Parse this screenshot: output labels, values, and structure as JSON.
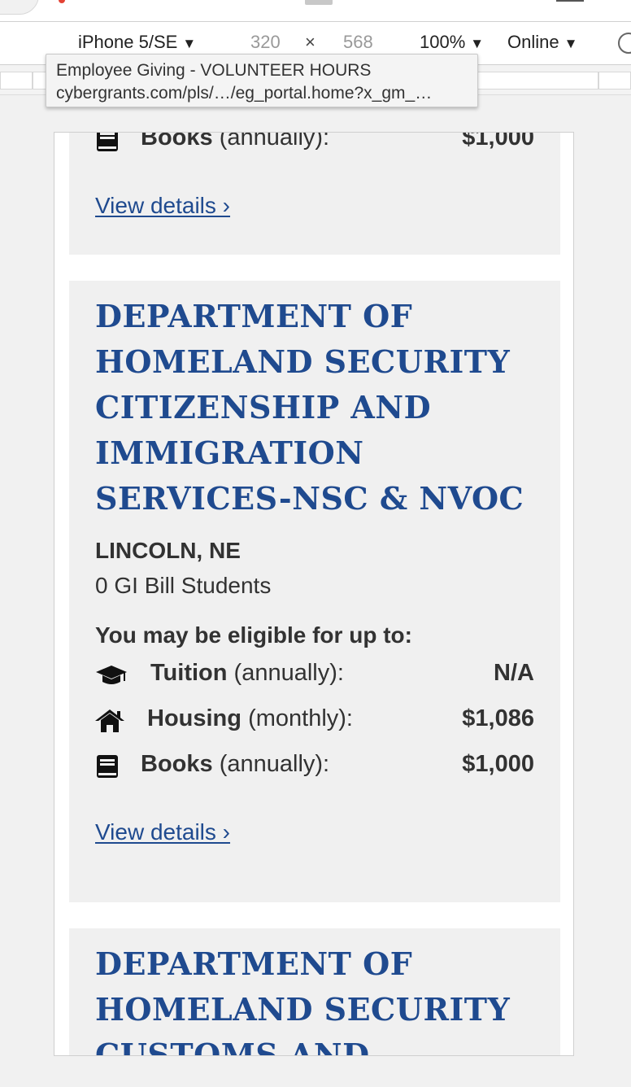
{
  "devtools": {
    "device": "iPhone 5/SE",
    "width": "320",
    "times": "×",
    "height": "568",
    "zoom": "100%",
    "network": "Online",
    "caret": "▼"
  },
  "tooltip": {
    "title": "Employee Giving - VOLUNTEER HOURS",
    "url": "cybergrants.com/pls/…/eg_portal.home?x_gm_…"
  },
  "cards": [
    {
      "books_label": "Books",
      "books_period": "(annually):",
      "books_value": "$1,000",
      "link": "View details ›"
    },
    {
      "title_lines": [
        "DEPARTMENT OF",
        "HOMELAND SECURITY",
        "CITIZENSHIP AND",
        "IMMIGRATION",
        "SERVICES-NSC & NVOC"
      ],
      "city": "LINCOLN, NE",
      "students": "0 GI Bill Students",
      "eligible": "You may be eligible for up to:",
      "benefits": [
        {
          "icon": "graduation-cap-icon",
          "label": "Tuition",
          "period": "(annually):",
          "value": "N/A"
        },
        {
          "icon": "home-icon",
          "label": "Housing",
          "period": "(monthly):",
          "value": "$1,086"
        },
        {
          "icon": "book-icon",
          "label": "Books",
          "period": "(annually):",
          "value": "$1,000"
        }
      ],
      "link": "View details ›"
    },
    {
      "title_lines": [
        "DEPARTMENT OF",
        "HOMELAND SECURITY",
        "CUSTOMS AND BORDER"
      ]
    }
  ],
  "colors": {
    "accent": "#1f4a8f",
    "card_bg": "#f0f0f0",
    "text": "#323232"
  }
}
